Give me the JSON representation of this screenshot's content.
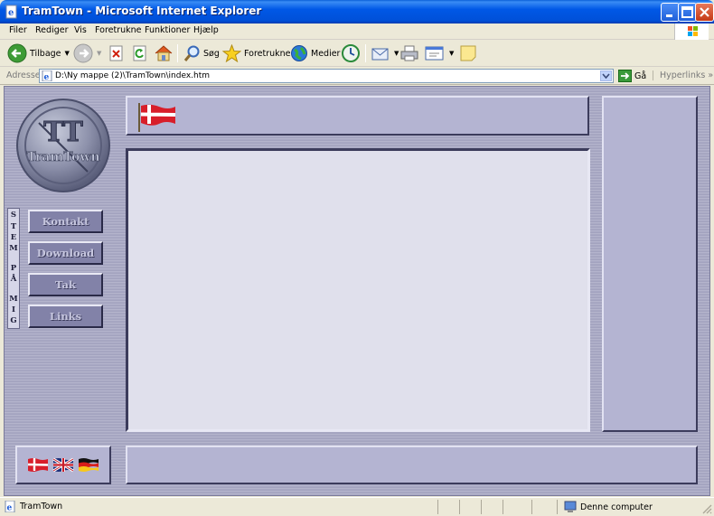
{
  "window": {
    "title": "TramTown - Microsoft Internet Explorer"
  },
  "menu": {
    "items": [
      "Filer",
      "Rediger",
      "Vis",
      "Foretrukne",
      "Funktioner",
      "Hjælp"
    ]
  },
  "toolbar": {
    "back_label": "Tilbage",
    "search_label": "Søg",
    "favorites_label": "Foretrukne",
    "media_label": "Medier"
  },
  "address": {
    "label": "Adresse",
    "value": "D:\\Ny mappe (2)\\TramTown\\index.htm",
    "go_label": "Gå",
    "links_label": "Hyperlinks"
  },
  "page": {
    "logo_text": "TramTown",
    "logo_letters": "TT",
    "vertical_text": [
      "S",
      "T",
      "E",
      "M",
      "P",
      "Å",
      "M",
      "I",
      "G"
    ],
    "nav_buttons": [
      "Kontakt",
      "Download",
      "Tak",
      "Links"
    ]
  },
  "status": {
    "text": "TramTown",
    "zone_label": "Denne computer"
  },
  "colors": {
    "titlebar": "#0058e6",
    "page_background": "#a8a8c4",
    "panel": "#b4b4d2",
    "main_panel": "#e0e0ec",
    "button": "#8282a8"
  }
}
